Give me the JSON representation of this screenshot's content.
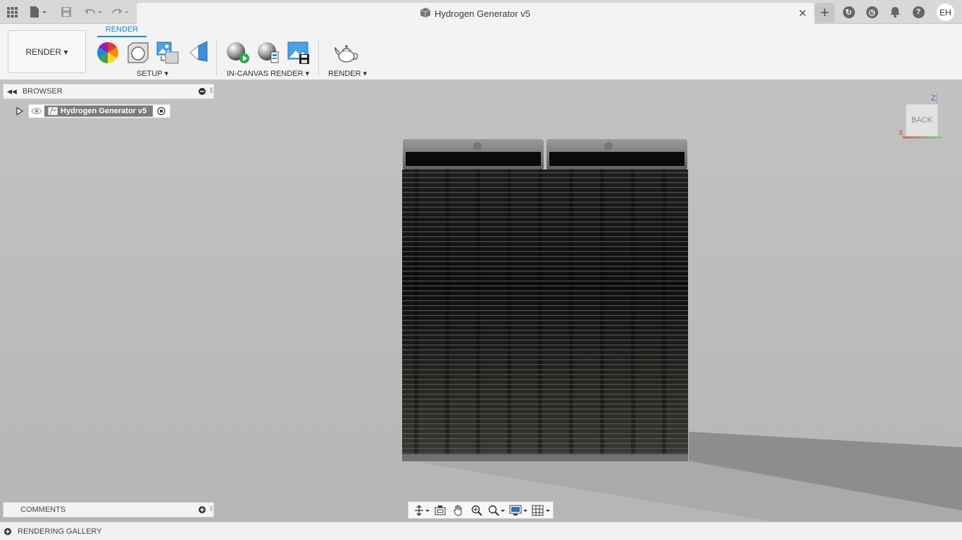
{
  "window": {
    "document_title": "Hydrogen Generator v5",
    "close_symbol": "✕",
    "new_tab_symbol": "+",
    "user_initials": "EH",
    "help_symbol": "?"
  },
  "toolbar": {
    "workspace_button": "RENDER ▾",
    "active_tab": "RENDER",
    "groups": {
      "setup": "SETUP ▾",
      "in_canvas_render": "IN-CANVAS RENDER ▾",
      "render": "RENDER ▾"
    }
  },
  "browser": {
    "header": "BROWSER",
    "root_node": "Hydrogen Generator v5"
  },
  "viewcube": {
    "face": "BACK",
    "axis_z": "Z",
    "axis_x": "X"
  },
  "comments": {
    "header": "COMMENTS"
  },
  "gallery": {
    "header": "RENDERING GALLERY"
  },
  "colors": {
    "accent": "#1a8ad3",
    "node_highlight": "#7c7c7c"
  }
}
